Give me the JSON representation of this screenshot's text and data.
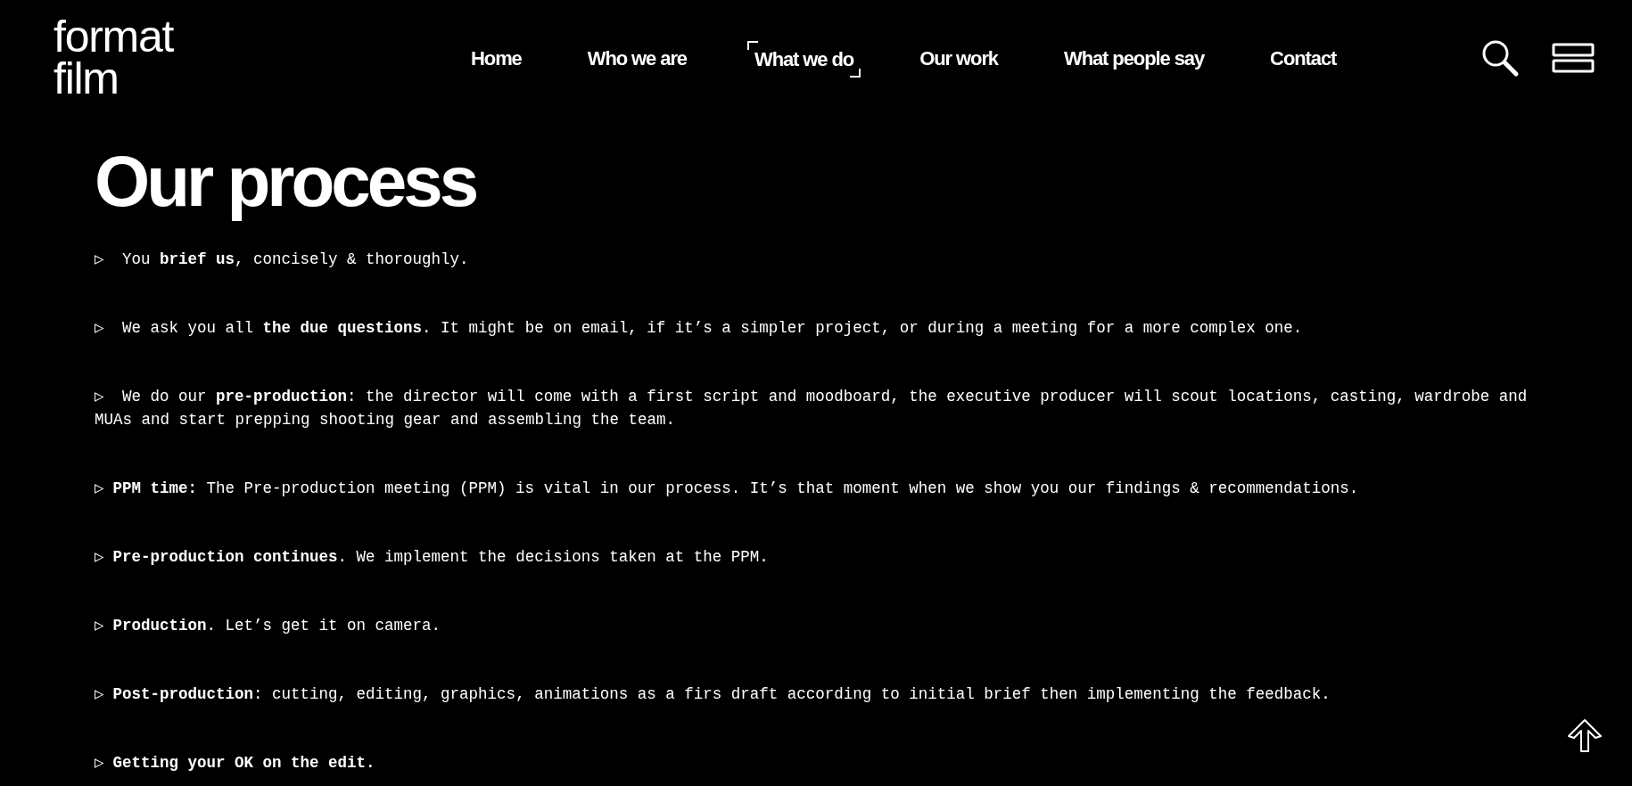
{
  "logo": {
    "lines": [
      "format",
      "film"
    ]
  },
  "nav": [
    {
      "label": "Home",
      "selected": false
    },
    {
      "label": "Who we are",
      "selected": false
    },
    {
      "label": "What we do",
      "selected": true
    },
    {
      "label": "Our work",
      "selected": false
    },
    {
      "label": "What people say",
      "selected": false
    },
    {
      "label": "Contact",
      "selected": false
    }
  ],
  "heading": "Our process",
  "steps": [
    {
      "marker": "▷",
      "text": " You **brief us**, concisely & thoroughly."
    },
    {
      "marker": "▷",
      "text": " We ask you all **the due questions**. It might be on email, if it’s a simpler project, or during a meeting for a more complex one."
    },
    {
      "marker": "▷",
      "text": " We do our **pre-production**: the director will come with a first script and moodboard, the executive producer will scout locations, casting, wardrobe and MUAs and start prepping shooting gear and assembling the team."
    },
    {
      "marker": "▷",
      "text": "**PPM time:** The Pre-production meeting (PPM) is vital in our process. It’s that moment when we show you our findings & recommendations."
    },
    {
      "marker": "▷",
      "text": "**Pre-production continues**. We implement the decisions taken at the PPM."
    },
    {
      "marker": "▷",
      "text": "**Production**. Let’s get it on camera."
    },
    {
      "marker": "▷",
      "text": "**Post-production**: cutting, editing, graphics, animations as a firs draft according to initial brief then implementing the feedback."
    },
    {
      "marker": "▷",
      "text": "**Getting your OK on the edit.**"
    }
  ]
}
